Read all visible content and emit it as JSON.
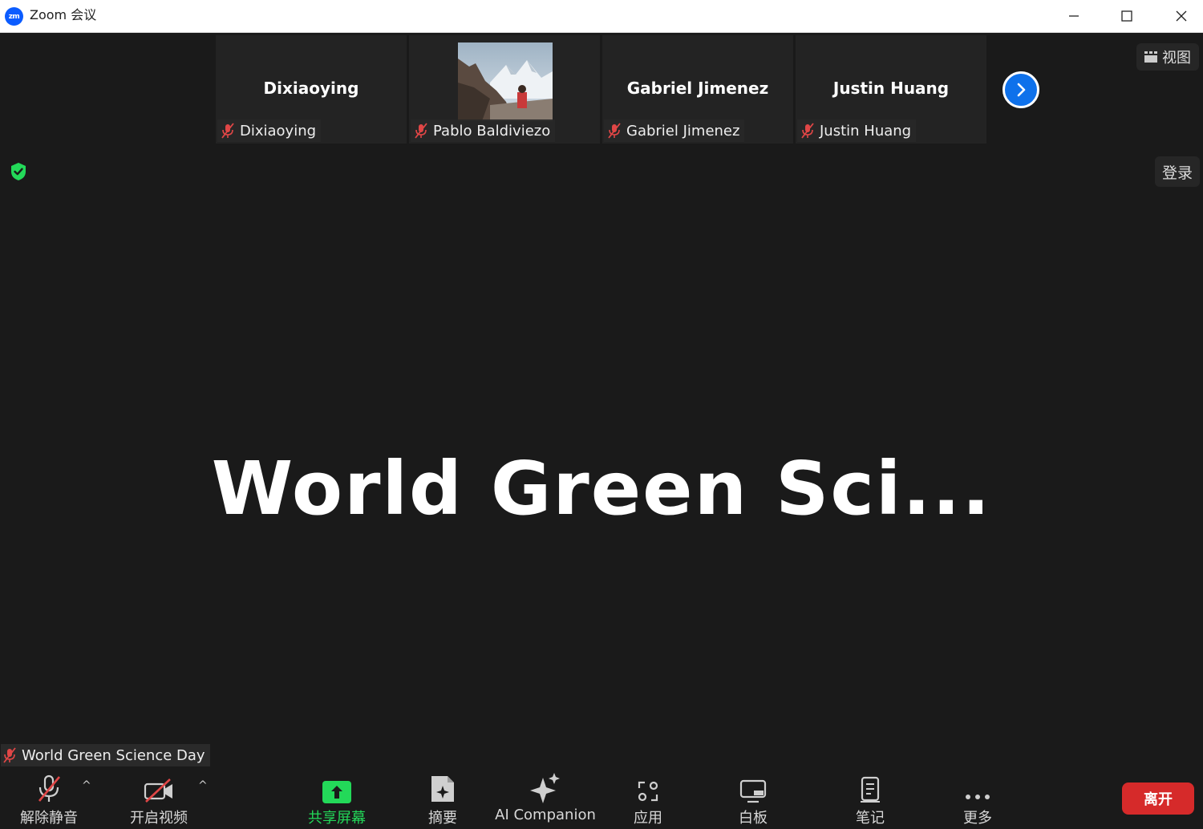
{
  "window": {
    "logo_text": "zm",
    "title": "Zoom 会议"
  },
  "participants": [
    {
      "name_center": "Dixiaoying",
      "label": "Dixiaoying",
      "has_photo": false
    },
    {
      "name_center": "",
      "label": "Pablo Baldiviezo",
      "has_photo": true
    },
    {
      "name_center": "Gabriel Jimenez",
      "label": "Gabriel Jimenez",
      "has_photo": false
    },
    {
      "name_center": "Justin Huang",
      "label": "Justin Huang",
      "has_photo": false
    }
  ],
  "top_right": {
    "view_label": "视图",
    "login_label": "登录"
  },
  "main": {
    "display_name": "World Green Sci...",
    "speaker_label": "World Green Science Day"
  },
  "toolbar": {
    "unmute_label": "解除静音",
    "video_label": "开启视频",
    "share_label": "共享屏幕",
    "summary_label": "摘要",
    "ai_label": "AI Companion",
    "apps_label": "应用",
    "whiteboard_label": "白板",
    "notes_label": "笔记",
    "more_label": "更多",
    "leave_label": "离开"
  },
  "colors": {
    "accent_blue": "#0e71eb",
    "share_green": "#23d959",
    "leave_red": "#d62a2a",
    "mute_red": "#e04646",
    "background": "#1a1a1a"
  }
}
